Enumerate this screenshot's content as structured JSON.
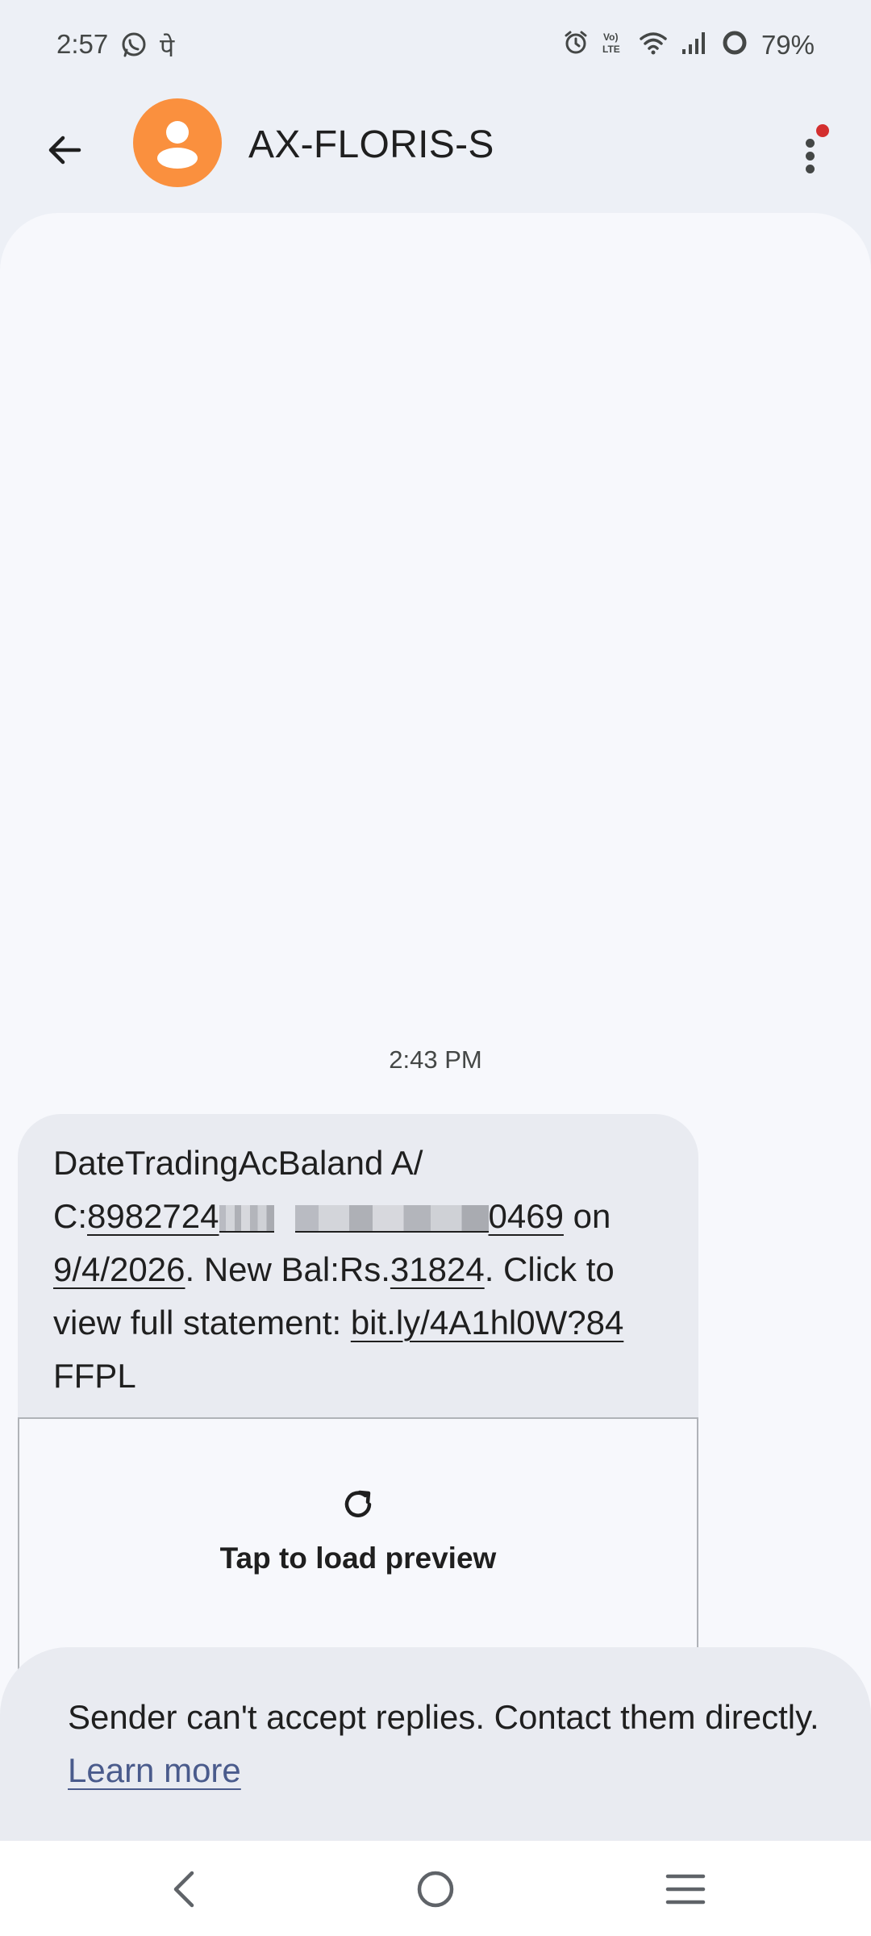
{
  "status_bar": {
    "time": "2:57",
    "left_icons": [
      "whatsapp-icon",
      "phonepe-icon"
    ],
    "phonepe_glyph": "पे",
    "right_icons": [
      "alarm-icon",
      "volte-icon",
      "wifi-icon",
      "signal-icon",
      "battery-icon"
    ],
    "battery_percent": "79%"
  },
  "header": {
    "contact_name": "AX-FLORIS-S",
    "avatar_color": "#fa903e",
    "has_notification_dot": true
  },
  "conversation": {
    "timestamp": "2:43 PM",
    "message": {
      "text_part1": "DateTradingAcBaland A/",
      "text_part2_prefix": "C:",
      "account_visible_start": "8982724",
      "account_visible_end": "0469",
      "text_after_account": " on",
      "date": "9/4/2026",
      "text_after_date": ". New Bal:Rs.",
      "balance": "31824",
      "text_after_balance": ". Click to",
      "text_line4": "view full statement: ",
      "link": "bit.ly/4A1hl0W?84",
      "text_line5": "FFPL"
    },
    "preview": {
      "label": "Tap to load preview",
      "icon": "refresh-icon"
    }
  },
  "notice": {
    "text": "Sender can't accept replies. Contact them directly. ",
    "link_label": "Learn more"
  },
  "nav_bar": {
    "buttons": [
      "back-nav-icon",
      "home-nav-icon",
      "recents-nav-icon"
    ]
  },
  "colors": {
    "accent_link": "#4a5b8c",
    "notification": "#d32f2f",
    "background": "#edf0f6"
  }
}
